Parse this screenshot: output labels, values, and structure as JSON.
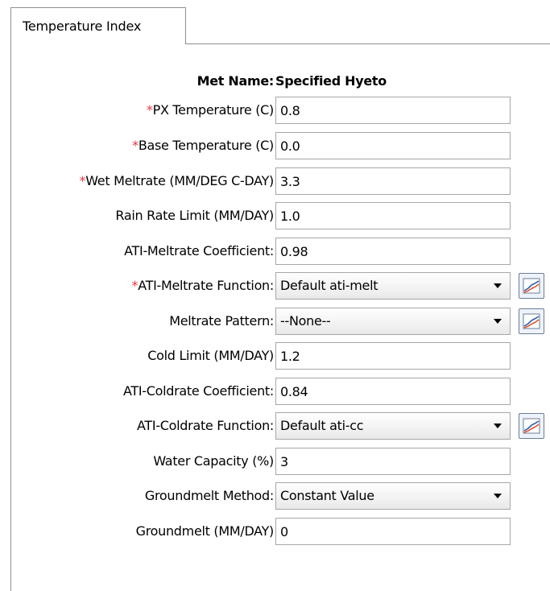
{
  "tab": {
    "label": "Temperature Index"
  },
  "met_name": {
    "label": "Met Name:",
    "value": "Specified Hyeto"
  },
  "required_marker": "*",
  "colors": {
    "required": "#e8383f",
    "graph_line_red": "#e2542a",
    "graph_line_blue": "#2b5fb3"
  },
  "fields": [
    {
      "label": "PX Temperature (C)",
      "required": "*",
      "value": "0.8"
    },
    {
      "label": "Base Temperature (C)",
      "required": "*",
      "value": "0.0"
    },
    {
      "label": "Wet Meltrate (MM/DEG C-DAY)",
      "required": "*",
      "value": "3.3"
    },
    {
      "label": "Rain Rate Limit (MM/DAY)",
      "required": "",
      "value": "1.0"
    },
    {
      "label": "ATI-Meltrate Coefficient:",
      "required": "",
      "value": "0.98"
    },
    {
      "label": "ATI-Meltrate Function:",
      "required": "*",
      "value": "Default ati-melt",
      "icon": "graph-icon"
    },
    {
      "label": "Meltrate Pattern:",
      "required": "",
      "value": "--None--",
      "icon": "graph-icon"
    },
    {
      "label": "Cold Limit (MM/DAY)",
      "required": "",
      "value": "1.2"
    },
    {
      "label": "ATI-Coldrate Coefficient:",
      "required": "",
      "value": "0.84"
    },
    {
      "label": "ATI-Coldrate Function:",
      "required": "",
      "value": "Default ati-cc",
      "icon": "graph-icon"
    },
    {
      "label": "Water Capacity (%)",
      "required": "",
      "value": "3"
    },
    {
      "label": "Groundmelt Method:",
      "required": "",
      "value": "Constant Value"
    },
    {
      "label": "Groundmelt (MM/DAY)",
      "required": "",
      "value": "0"
    }
  ]
}
